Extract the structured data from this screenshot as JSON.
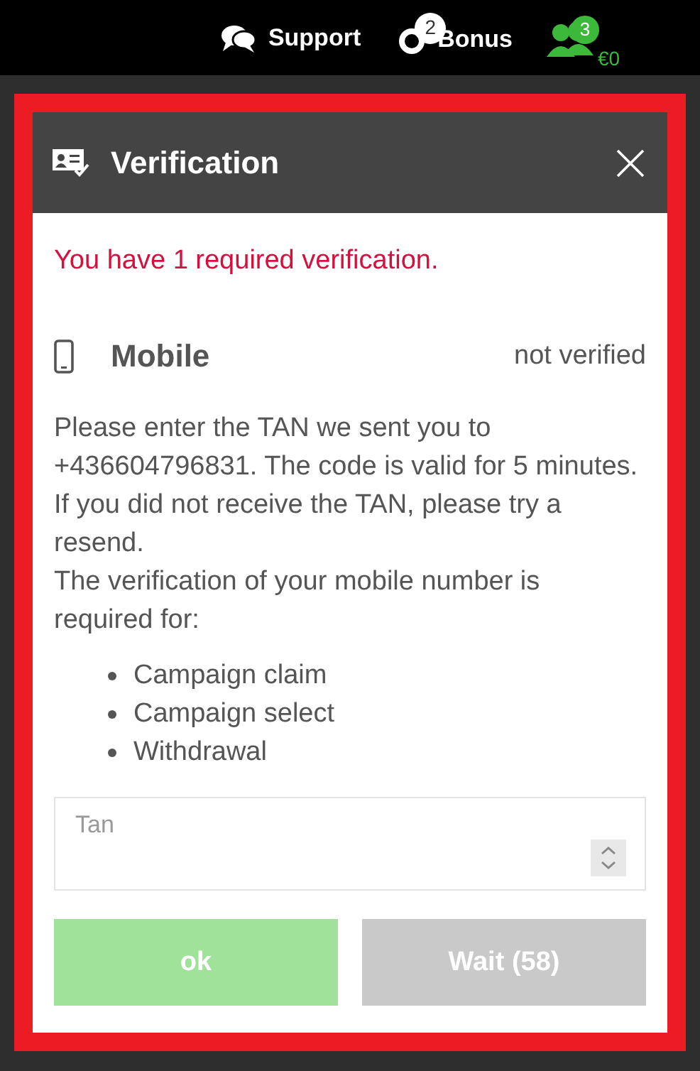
{
  "topbar": {
    "support": "Support",
    "bonus": {
      "label": "Bonus",
      "count": "2"
    },
    "account": {
      "count": "3",
      "balance": "€0"
    }
  },
  "dialog": {
    "title": "Verification",
    "alert": "You have 1 required verification.",
    "method": {
      "name": "Mobile",
      "status": "not verified"
    },
    "message": [
      "Please enter the TAN we sent you to +436604796831. The code is valid for 5 minutes. If you did not receive the TAN, please try a resend.",
      "The verification of your mobile number is required for:"
    ],
    "requirements": [
      "Campaign claim",
      "Campaign select",
      "Withdrawal"
    ],
    "tan_field": {
      "placeholder": "Tan"
    },
    "buttons": [
      {
        "label": "ok",
        "kind": "confirm",
        "disabled": true
      },
      {
        "label": "Wait (58)",
        "kind": "resend",
        "disabled": true
      }
    ]
  }
}
